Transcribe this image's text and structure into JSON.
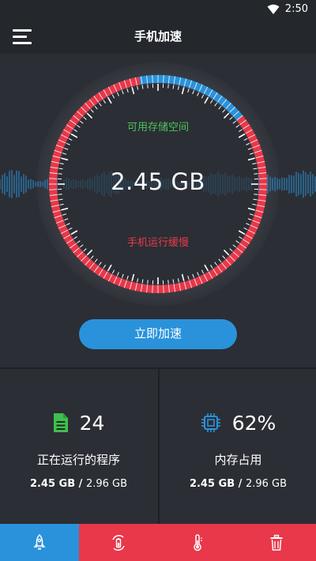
{
  "status_bar": {
    "time": "2:50"
  },
  "app_bar": {
    "title": "手机加速",
    "menu_icon": "hamburger-menu-icon"
  },
  "gauge": {
    "storage_label": "可用存储空间",
    "storage_value": "2.45 GB",
    "status_text": "手机运行缓慢",
    "used_fraction": 0.83,
    "colors": {
      "used": "#e8384a",
      "free": "#2a92db",
      "wave": "#2a92db",
      "label_green": "#4cc35c"
    }
  },
  "boost_button": {
    "label": "立即加速"
  },
  "stats": {
    "processes": {
      "icon": "document-icon",
      "count": "24",
      "label": "正在运行的程序",
      "used": "2.45 GB",
      "separator": " / ",
      "total": "2.96 GB"
    },
    "memory": {
      "icon": "cpu-chip-icon",
      "percent": "62%",
      "label": "内存占用",
      "used": "2.45 GB",
      "separator": " / ",
      "total": "2.96 GB"
    }
  },
  "bottom_nav": {
    "tabs": [
      {
        "name": "boost",
        "icon": "rocket-icon",
        "active": true
      },
      {
        "name": "battery",
        "icon": "battery-cycle-icon",
        "active": false
      },
      {
        "name": "cooler",
        "icon": "thermometer-icon",
        "active": false
      },
      {
        "name": "cleaner",
        "icon": "trash-icon",
        "active": false
      }
    ]
  }
}
